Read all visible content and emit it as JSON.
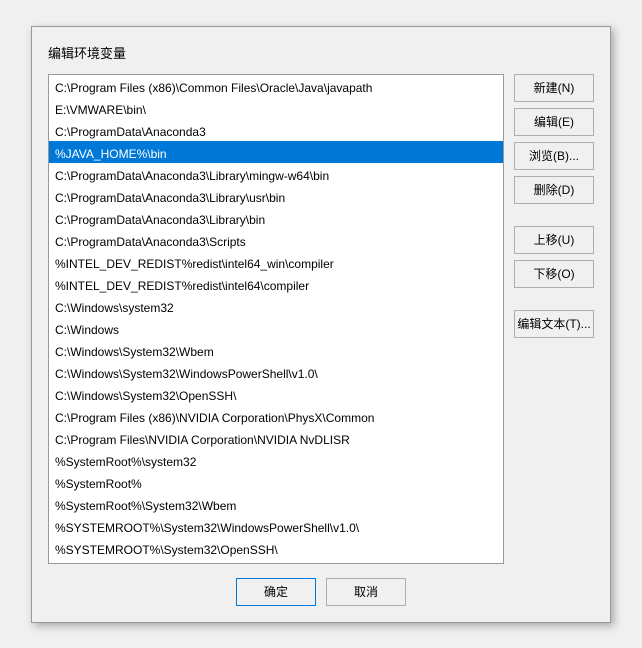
{
  "dialog": {
    "title": "编辑环境变量",
    "list_items": [
      {
        "text": "C:\\Program Files (x86)\\Common Files\\Oracle\\Java\\javapath",
        "selected": false
      },
      {
        "text": "E:\\VMWARE\\bin\\",
        "selected": false
      },
      {
        "text": "C:\\ProgramData\\Anaconda3",
        "selected": false
      },
      {
        "text": "%JAVA_HOME%\\bin",
        "selected": true
      },
      {
        "text": "C:\\ProgramData\\Anaconda3\\Library\\mingw-w64\\bin",
        "selected": false
      },
      {
        "text": "C:\\ProgramData\\Anaconda3\\Library\\usr\\bin",
        "selected": false
      },
      {
        "text": "C:\\ProgramData\\Anaconda3\\Library\\bin",
        "selected": false
      },
      {
        "text": "C:\\ProgramData\\Anaconda3\\Scripts",
        "selected": false
      },
      {
        "text": "%INTEL_DEV_REDIST%redist\\intel64_win\\compiler",
        "selected": false
      },
      {
        "text": "%INTEL_DEV_REDIST%redist\\intel64\\compiler",
        "selected": false
      },
      {
        "text": "C:\\Windows\\system32",
        "selected": false
      },
      {
        "text": "C:\\Windows",
        "selected": false
      },
      {
        "text": "C:\\Windows\\System32\\Wbem",
        "selected": false
      },
      {
        "text": "C:\\Windows\\System32\\WindowsPowerShell\\v1.0\\",
        "selected": false
      },
      {
        "text": "C:\\Windows\\System32\\OpenSSH\\",
        "selected": false
      },
      {
        "text": "C:\\Program Files (x86)\\NVIDIA Corporation\\PhysX\\Common",
        "selected": false
      },
      {
        "text": "C:\\Program Files\\NVIDIA Corporation\\NVIDIA NvDLISR",
        "selected": false
      },
      {
        "text": "%SystemRoot%\\system32",
        "selected": false
      },
      {
        "text": "%SystemRoot%",
        "selected": false
      },
      {
        "text": "%SystemRoot%\\System32\\Wbem",
        "selected": false
      },
      {
        "text": "%SYSTEMROOT%\\System32\\WindowsPowerShell\\v1.0\\",
        "selected": false
      },
      {
        "text": "%SYSTEMROOT%\\System32\\OpenSSH\\",
        "selected": false
      }
    ],
    "buttons": {
      "new": "新建(N)",
      "edit": "编辑(E)",
      "browse": "浏览(B)...",
      "delete": "删除(D)",
      "move_up": "上移(U)",
      "move_down": "下移(O)",
      "edit_text": "编辑文本(T)..."
    },
    "footer": {
      "ok": "确定",
      "cancel": "取消"
    }
  }
}
